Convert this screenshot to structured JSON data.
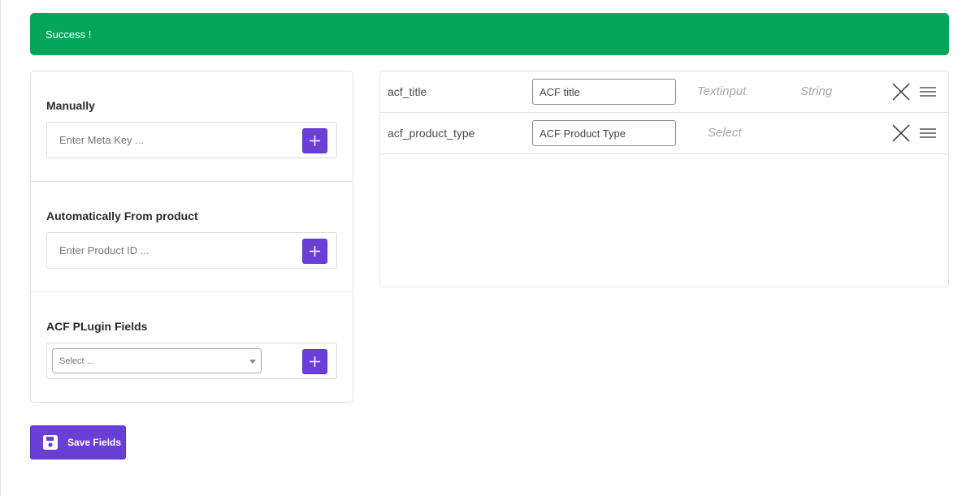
{
  "alert": {
    "message": "Success !",
    "color": "#03a559"
  },
  "left_panel": {
    "manual": {
      "title": "Manually",
      "placeholder": "Enter Meta Key ...",
      "add_icon": "plus-icon"
    },
    "from_product": {
      "title": "Automatically From product",
      "placeholder": "Enter Product ID ...",
      "add_icon": "plus-icon"
    },
    "acf_plugin": {
      "title": "ACF PLugin Fields",
      "select_value": "Select ...",
      "add_icon": "plus-icon"
    }
  },
  "save_button": {
    "label": "Save Fields",
    "icon": "floppy-disk-icon"
  },
  "fields": [
    {
      "key": "acf_title",
      "label": "ACF title",
      "type": "Textinput",
      "datatype": "String"
    },
    {
      "key": "acf_product_type",
      "label": "ACF Product Type",
      "type": "Select",
      "datatype": ""
    }
  ],
  "colors": {
    "accent": "#6a3fd6",
    "success": "#03a559"
  }
}
